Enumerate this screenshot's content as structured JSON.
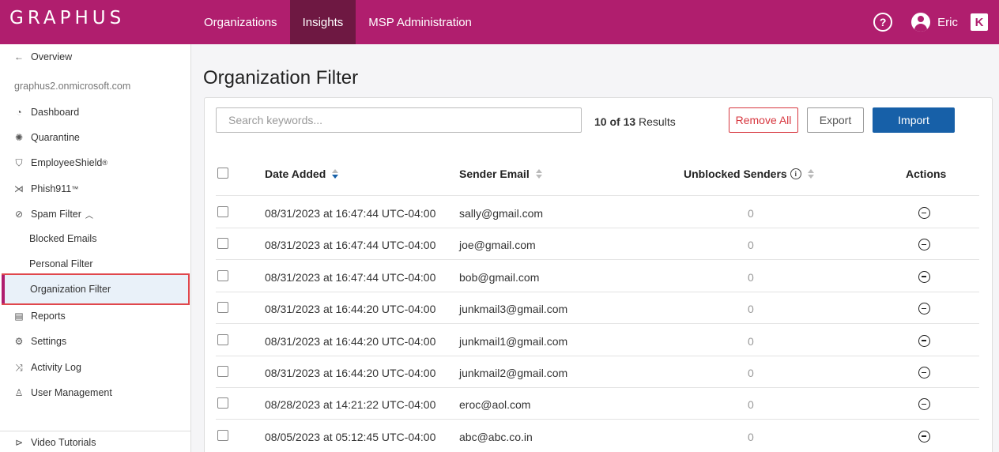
{
  "app": {
    "logo": "GRAPHUS"
  },
  "nav": {
    "items": [
      "Organizations",
      "Insights",
      "MSP Administration"
    ],
    "active": "Insights"
  },
  "user": {
    "name": "Eric",
    "help_icon": "question-circle-icon",
    "brand_glyph": "K"
  },
  "sidebar": {
    "back_label": "Overview",
    "tenant": "graphus2.onmicrosoft.com",
    "items": [
      {
        "label": "Dashboard",
        "icon": "dashboard-icon"
      },
      {
        "label": "Quarantine",
        "icon": "virus-icon"
      },
      {
        "label": "EmployeeShield",
        "icon": "shield-icon",
        "sup": "®"
      },
      {
        "label": "Phish911",
        "icon": "fish-icon",
        "sup": "™"
      },
      {
        "label": "Spam Filter",
        "icon": "block-icon"
      },
      {
        "label": "Blocked Emails"
      },
      {
        "label": "Personal Filter"
      },
      {
        "label": "Organization Filter"
      },
      {
        "label": "Reports",
        "icon": "document-icon"
      },
      {
        "label": "Settings",
        "icon": "gear-icon"
      },
      {
        "label": "Activity Log",
        "icon": "shuffle-icon"
      },
      {
        "label": "User Management",
        "icon": "user-icon"
      }
    ],
    "video_label": "Video Tutorials"
  },
  "page": {
    "title": "Organization Filter"
  },
  "toolbar": {
    "search_placeholder": "Search keywords...",
    "results_shown": "10 of 13",
    "results_label": "Results",
    "remove_all": "Remove All",
    "export": "Export",
    "import": "Import"
  },
  "colors": {
    "brand": "#b01e6e",
    "nav_active": "#6e1842",
    "primary": "#1760a8",
    "danger": "#d7373f"
  },
  "table": {
    "columns": {
      "date": "Date Added",
      "email": "Sender Email",
      "unblocked": "Unblocked Senders",
      "actions": "Actions"
    },
    "rows": [
      {
        "date": "08/31/2023 at 16:47:44 UTC-04:00",
        "email": "sally@gmail.com",
        "count": "0"
      },
      {
        "date": "08/31/2023 at 16:47:44 UTC-04:00",
        "email": "joe@gmail.com",
        "count": "0"
      },
      {
        "date": "08/31/2023 at 16:47:44 UTC-04:00",
        "email": "bob@gmail.com",
        "count": "0"
      },
      {
        "date": "08/31/2023 at 16:44:20 UTC-04:00",
        "email": "junkmail3@gmail.com",
        "count": "0"
      },
      {
        "date": "08/31/2023 at 16:44:20 UTC-04:00",
        "email": "junkmail1@gmail.com",
        "count": "0"
      },
      {
        "date": "08/31/2023 at 16:44:20 UTC-04:00",
        "email": "junkmail2@gmail.com",
        "count": "0"
      },
      {
        "date": "08/28/2023 at 14:21:22 UTC-04:00",
        "email": "eroc@aol.com",
        "count": "0"
      },
      {
        "date": "08/05/2023 at 05:12:45 UTC-04:00",
        "email": "abc@abc.co.in",
        "count": "0"
      }
    ]
  }
}
